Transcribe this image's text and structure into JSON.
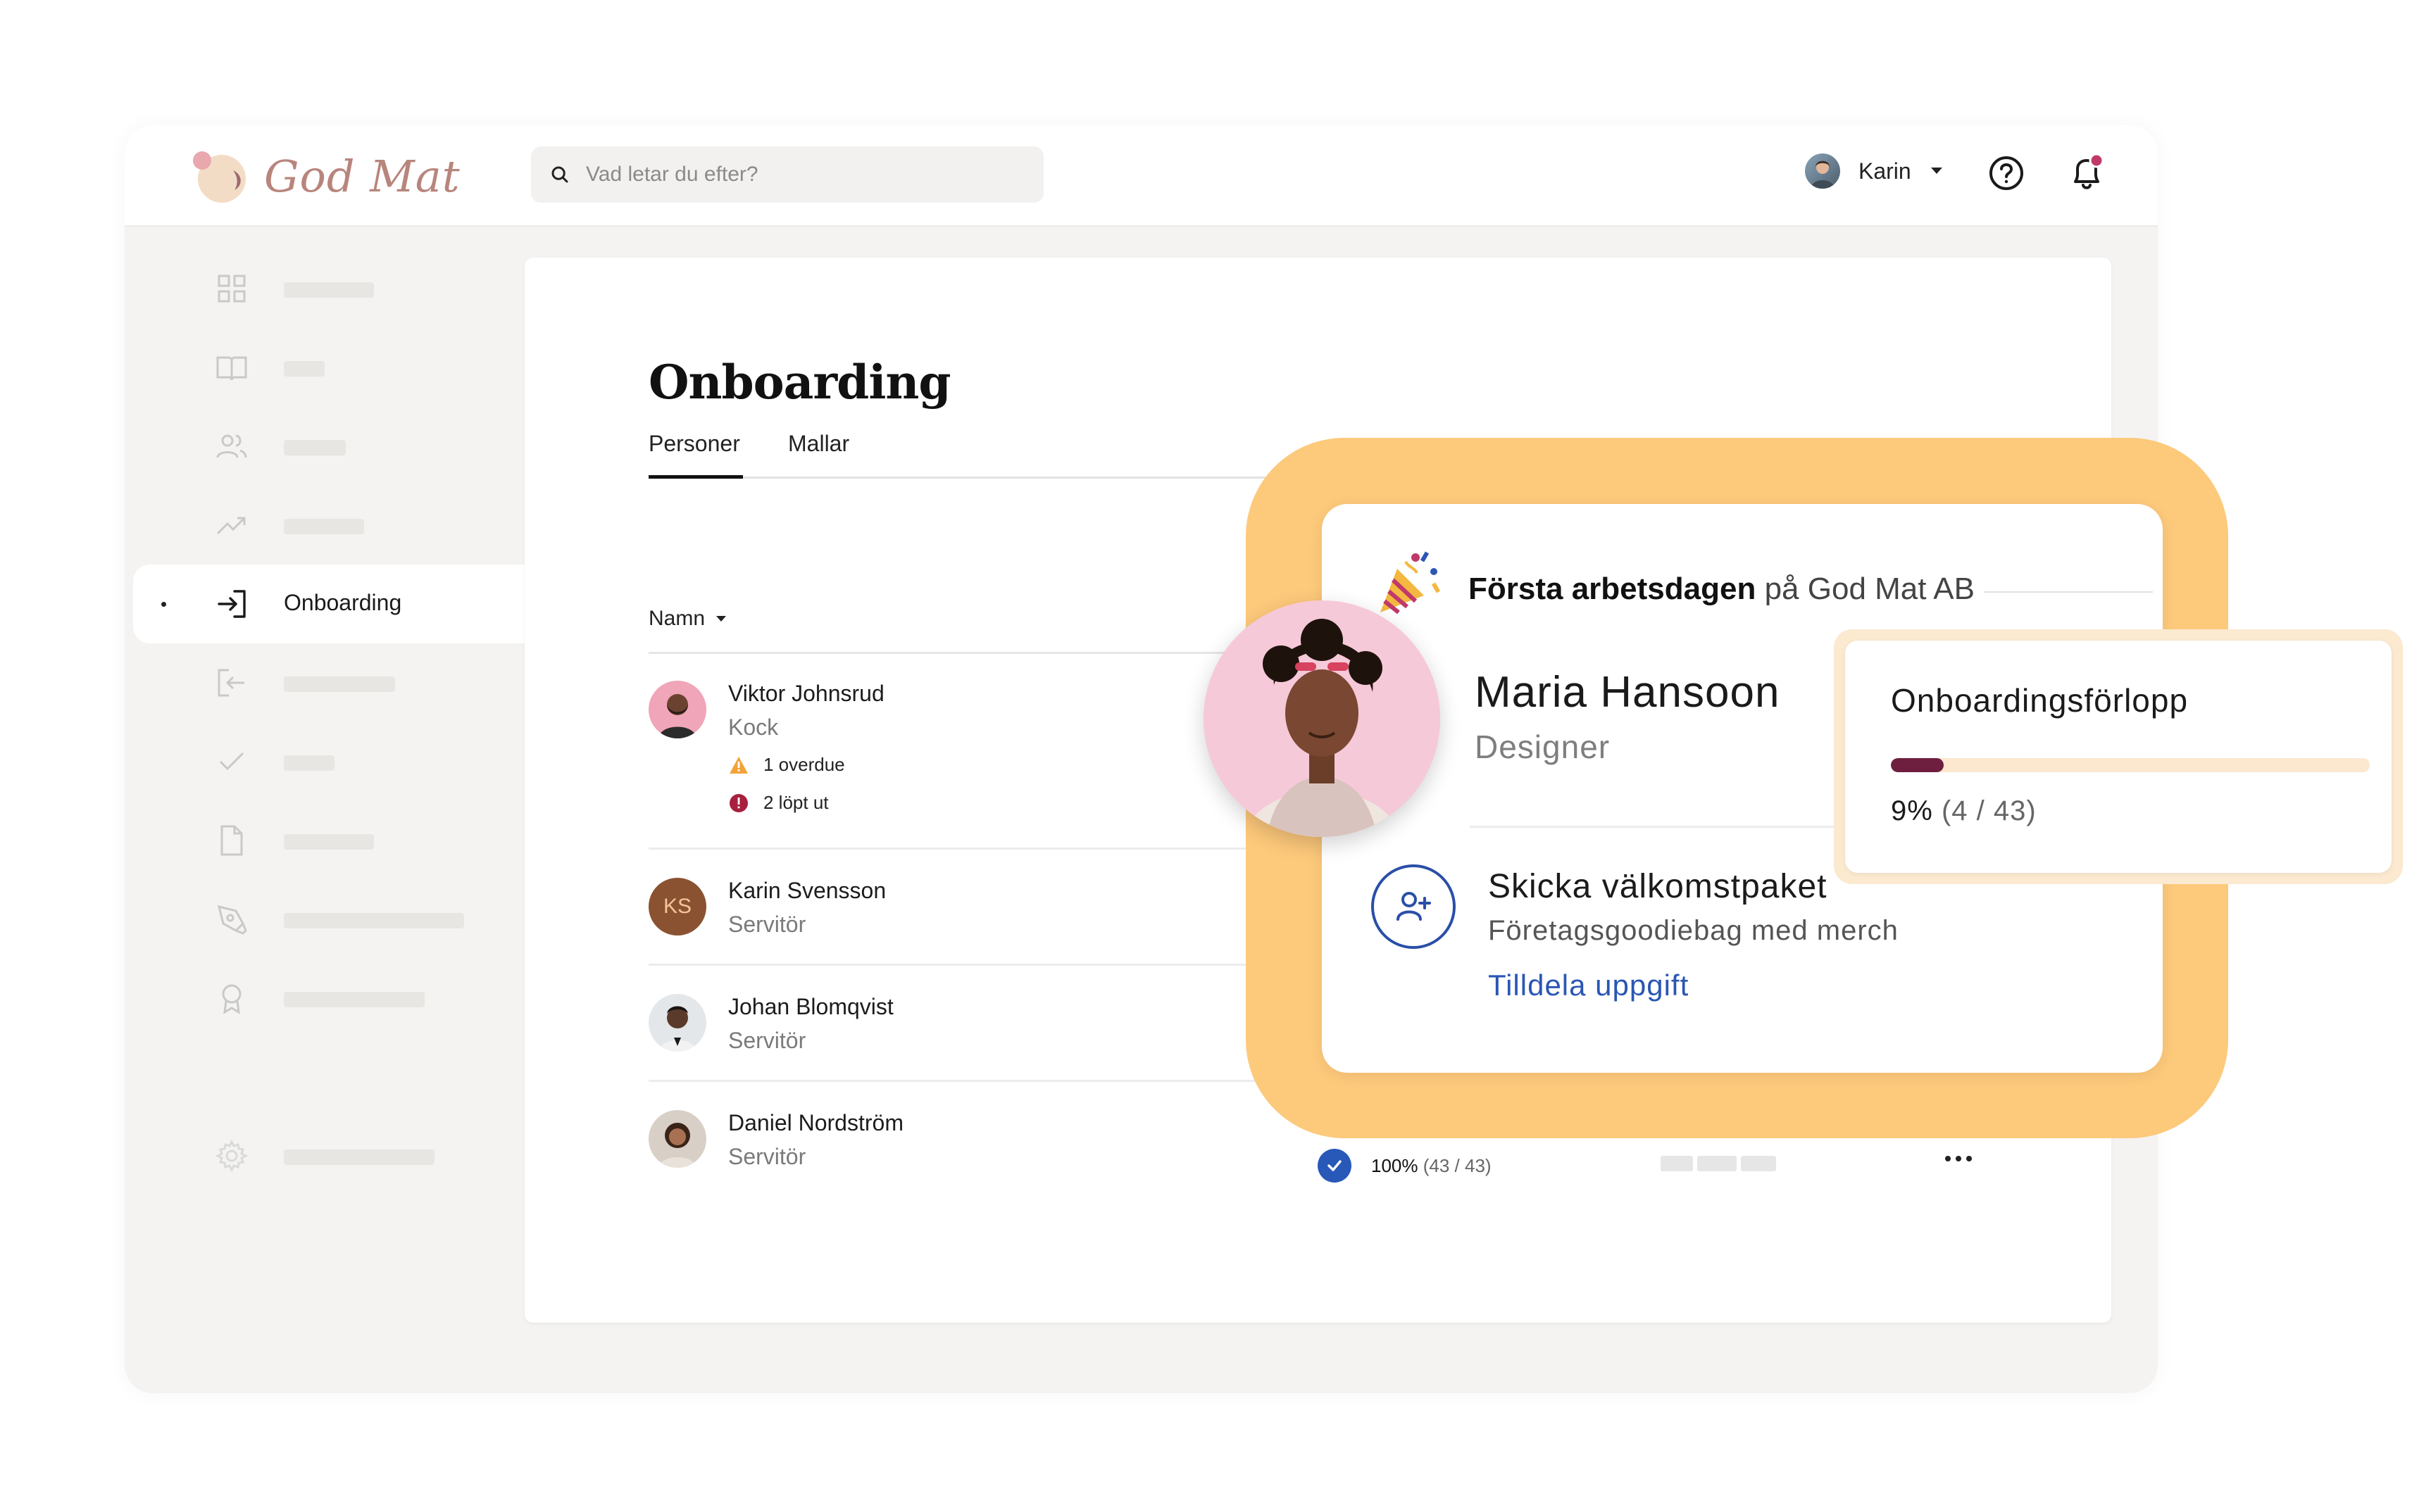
{
  "app": {
    "brand": "God Mat",
    "search_placeholder": "Vad letar du efter?",
    "user_name": "Karin",
    "colors": {
      "brand": "#b8857c",
      "accent": "#2a56b4",
      "halo": "#fdc97b",
      "progress": "#6e1f3f"
    }
  },
  "sidebar": {
    "items": [
      {
        "icon": "grid-icon",
        "label": ""
      },
      {
        "icon": "book-icon",
        "label": ""
      },
      {
        "icon": "users-icon",
        "label": ""
      },
      {
        "icon": "trending-icon",
        "label": ""
      },
      {
        "icon": "sign-in-icon",
        "label": "Onboarding",
        "active": true
      },
      {
        "icon": "sign-out-icon",
        "label": ""
      },
      {
        "icon": "check-icon",
        "label": ""
      },
      {
        "icon": "document-icon",
        "label": ""
      },
      {
        "icon": "pen-tool-icon",
        "label": ""
      },
      {
        "icon": "award-icon",
        "label": ""
      },
      {
        "icon": "gear-icon",
        "label": ""
      }
    ]
  },
  "page": {
    "title": "Onboarding",
    "tabs": [
      "Personer",
      "Mallar"
    ],
    "column_name": "Namn"
  },
  "people": [
    {
      "name": "Viktor Johnsrud",
      "role": "Kock",
      "overdue": "1 overdue",
      "expired": "2 löpt ut"
    },
    {
      "name": "Karin Svensson",
      "role": "Servitör",
      "initials": "KS"
    },
    {
      "name": "Johan Blomqvist",
      "role": "Servitör"
    },
    {
      "name": "Daniel Nordström",
      "role": "Servitör",
      "progress_pct": "100%",
      "progress_count": "(43 / 43)",
      "progress_value": 1.0
    }
  ],
  "overlay": {
    "event_title_bold": "Första arbetsdagen",
    "event_title_rest": "på God Mat AB",
    "person_name": "Maria Hansoon",
    "person_role": "Designer",
    "task_title": "Skicka välkomstpaket",
    "task_subtitle": "Företagsgoodiebag med merch",
    "task_link": "Tilldela uppgift",
    "progress_title": "Onboardingsförlopp",
    "progress_pct": "9%",
    "progress_count": "(4 / 43)",
    "progress_value": 0.09
  }
}
